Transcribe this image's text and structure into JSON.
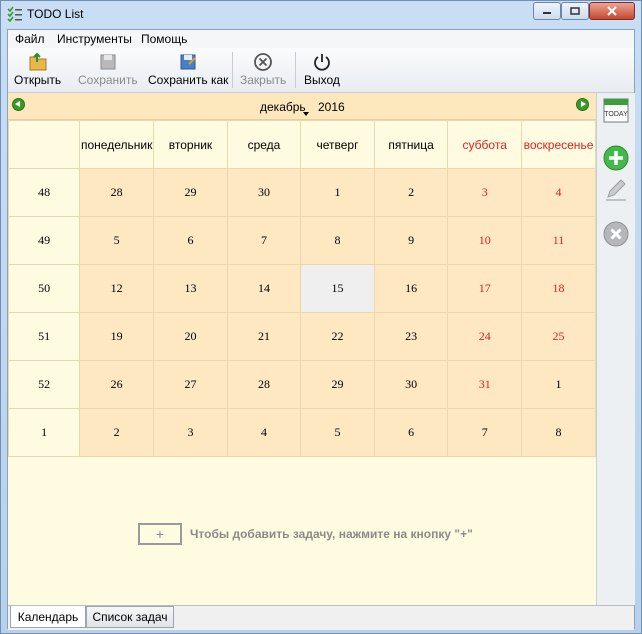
{
  "window": {
    "title": "TODO List"
  },
  "menu": [
    "Файл",
    "Инструменты",
    "Помощь"
  ],
  "toolbar": {
    "open": "Открыть",
    "save": "Сохранить",
    "save_as": "Сохранить как",
    "close": "Закрыть",
    "exit": "Выход"
  },
  "calendar": {
    "month": "декабрь",
    "year": "2016",
    "weekdays": [
      "понедельник",
      "вторник",
      "среда",
      "четверг",
      "пятница",
      "суббота",
      "воскресенье"
    ],
    "weeks": [
      {
        "week": "48",
        "days": [
          "28",
          "29",
          "30",
          "1",
          "2",
          "3",
          "4"
        ]
      },
      {
        "week": "49",
        "days": [
          "5",
          "6",
          "7",
          "8",
          "9",
          "10",
          "11"
        ]
      },
      {
        "week": "50",
        "days": [
          "12",
          "13",
          "14",
          "15",
          "16",
          "17",
          "18"
        ]
      },
      {
        "week": "51",
        "days": [
          "19",
          "20",
          "21",
          "22",
          "23",
          "24",
          "25"
        ]
      },
      {
        "week": "52",
        "days": [
          "26",
          "27",
          "28",
          "29",
          "30",
          "31",
          "1"
        ]
      },
      {
        "week": "1",
        "days": [
          "2",
          "3",
          "4",
          "5",
          "6",
          "7",
          "8"
        ]
      }
    ],
    "weekend_color": "#e02020"
  },
  "empty_hint": {
    "plus": "+",
    "text": "Чтобы добавить задачу, нажмите на кнопку \"+\""
  },
  "side": {
    "today_icon_text": "TODAY"
  },
  "tabs": [
    "Календарь",
    "Список задач"
  ]
}
